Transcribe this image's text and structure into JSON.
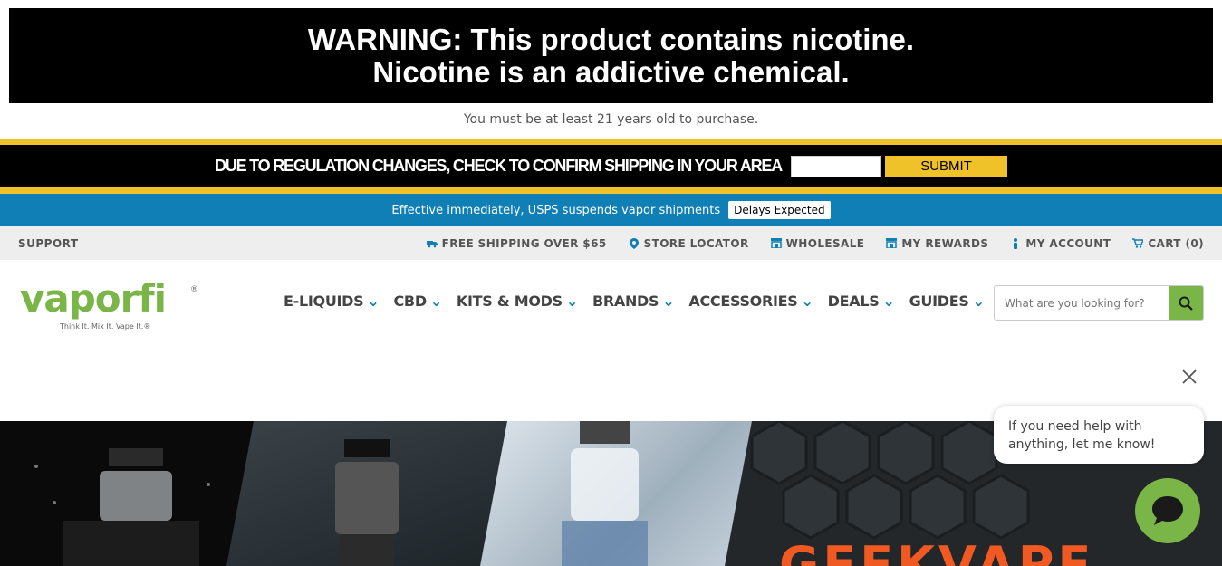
{
  "warning": {
    "line1": "WARNING: This product contains nicotine.",
    "line2": "Nicotine is an addictive chemical."
  },
  "age_notice": "You must be at least 21 years old to purchase.",
  "regulation": {
    "text": "DUE TO REGULATION CHANGES, CHECK TO CONFIRM SHIPPING IN YOUR AREA",
    "input_value": "",
    "submit_label": "SUBMIT"
  },
  "usps": {
    "text": "Effective immediately, USPS suspends vapor shipments",
    "badge": "Delays Expected"
  },
  "utility": {
    "support": "SUPPORT",
    "links": [
      {
        "label": "FREE SHIPPING OVER $65",
        "icon": "truck-icon"
      },
      {
        "label": "STORE LOCATOR",
        "icon": "map-pin-icon"
      },
      {
        "label": "WHOLESALE",
        "icon": "store-icon"
      },
      {
        "label": "MY REWARDS",
        "icon": "store-icon"
      },
      {
        "label": "MY ACCOUNT",
        "icon": "user-icon"
      },
      {
        "label": "CART (0)",
        "icon": "cart-icon"
      }
    ]
  },
  "logo": {
    "text": "vaporfi",
    "tagline": "Think It. Mix It. Vape It.®"
  },
  "nav": [
    {
      "label": "E-LIQUIDS"
    },
    {
      "label": "CBD"
    },
    {
      "label": "KITS & MODS"
    },
    {
      "label": "BRANDS"
    },
    {
      "label": "ACCESSORIES"
    },
    {
      "label": "DEALS"
    },
    {
      "label": "GUIDES"
    }
  ],
  "search": {
    "placeholder": "What are you looking for?",
    "value": ""
  },
  "hero": {
    "brand_text": "GEEKVAPE"
  },
  "chat": {
    "message": "If you need help with anything, let me know!"
  },
  "colors": {
    "accent_blue": "#0f7fb6",
    "accent_yellow": "#f0c22a",
    "brand_green": "#7ab547",
    "hero_orange": "#f05a22"
  }
}
